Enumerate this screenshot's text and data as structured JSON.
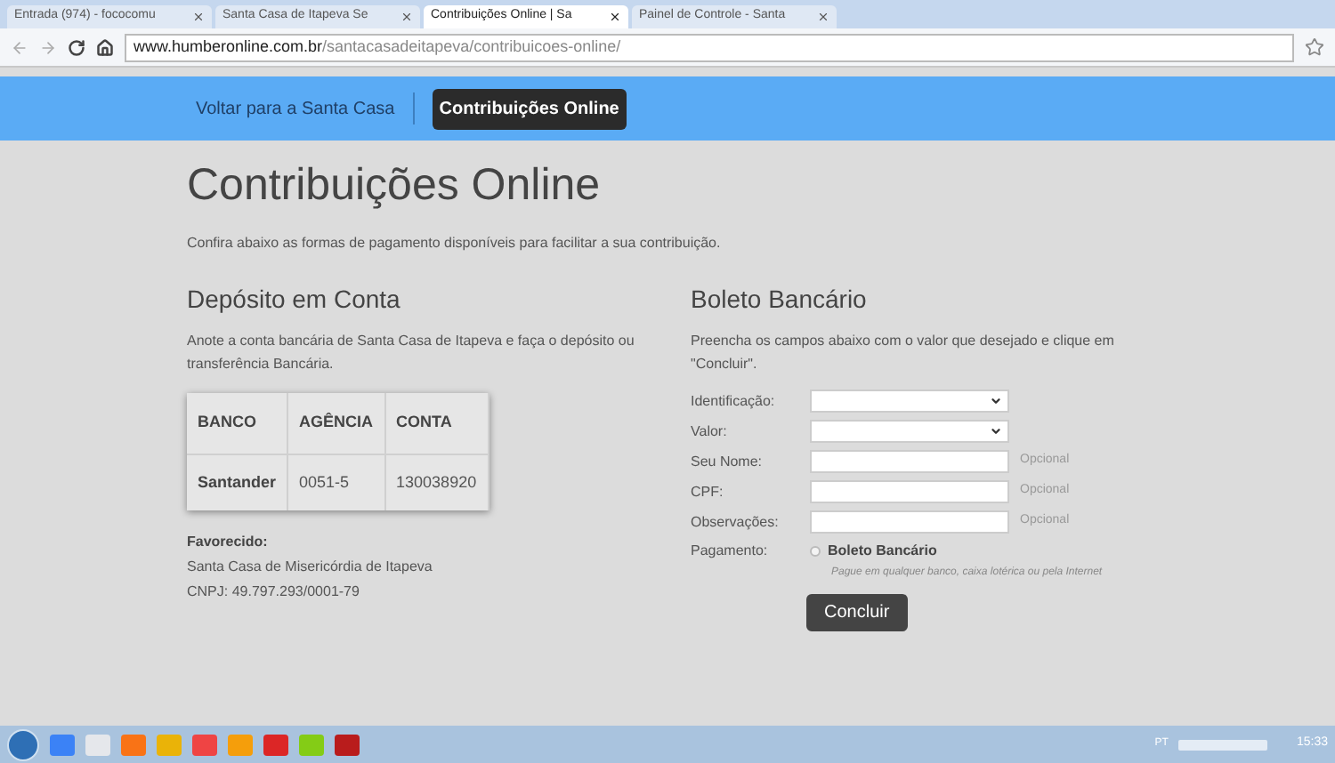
{
  "browser": {
    "tabs": [
      {
        "title": "Entrada (974) - fococomu",
        "selected": false
      },
      {
        "title": "Santa Casa de Itapeva Se",
        "selected": false
      },
      {
        "title": "Contribuições Online | Sa",
        "selected": true
      },
      {
        "title": "Painel de Controle - Santa",
        "selected": false
      }
    ],
    "url_host": "www.humberonline.com.br",
    "url_path": "/santacasadeitapeva/contribuicoes-online/"
  },
  "nav": [
    {
      "label": "Voltar para a Santa Casa",
      "selected": false
    },
    {
      "label": "Contribuições Online",
      "selected": true
    }
  ],
  "page": {
    "title": "Contribuições Online",
    "intro": "Confira abaixo as formas de pagamento disponíveis para facilitar a sua contribuição."
  },
  "deposit": {
    "heading": "Depósito em Conta",
    "text": "Anote a conta bancária de Santa Casa de Itapeva e faça o depósito ou transferência Bancária.",
    "table": {
      "columns": [
        "BANCO",
        "AGÊNCIA",
        "CONTA"
      ],
      "rows": [
        [
          "Santander",
          "0051-5",
          "130038920"
        ]
      ]
    },
    "favored_label": "Favorecido:",
    "favored_name": "Santa Casa de Misericórdia de Itapeva",
    "cnpj": "CNPJ: 49.797.293/0001-79"
  },
  "boleto": {
    "heading": "Boleto Bancário",
    "text": "Preencha os campos abaixo com o valor que desejado e clique em \"Concluir\".",
    "fields": [
      {
        "label": "Identificação:",
        "kind": "select"
      },
      {
        "label": "Valor:",
        "kind": "select"
      },
      {
        "label": "Seu Nome:",
        "kind": "text",
        "hint": "Opcional"
      },
      {
        "label": "CPF:",
        "kind": "text",
        "hint": "Opcional"
      },
      {
        "label": "Observações:",
        "kind": "text",
        "hint": "Opcional"
      }
    ],
    "payment": {
      "label": "Pagamento:",
      "option": "Boleto Bancário",
      "selected": false,
      "note": "Pague em qualquer banco, caixa lotérica ou pela Internet"
    },
    "submit": "Concluir"
  },
  "taskbar": {
    "language": "PT",
    "time": "15:33"
  }
}
